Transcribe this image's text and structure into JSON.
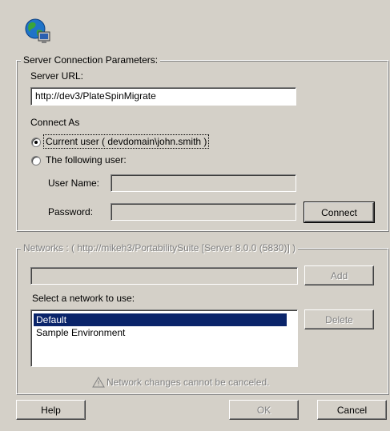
{
  "icon": "globe-computer-icon",
  "server_group": {
    "title": "Server Connection Parameters:",
    "url_label": "Server URL:",
    "url_value": "http://dev3/PlateSpinMigrate",
    "connect_as_label": "Connect As",
    "current_user_label": "Current user ( devdomain\\john.smith )",
    "following_user_label": "The following user:",
    "username_label": "User Name:",
    "username_value": "",
    "password_label": "Password:",
    "password_value": "",
    "connect_button": "Connect"
  },
  "networks_group": {
    "title": "Networks : ( http://mikeh3/PortabilitySuite [Server 8.0.0 (5830)] )",
    "new_network_value": "",
    "add_button": "Add",
    "select_label": "Select a network to use:",
    "networks": [
      "Default",
      "Sample Environment"
    ],
    "selected_index": 0,
    "delete_button": "Delete",
    "warning_icon": "warning-icon",
    "warning_text": "Network changes cannot be canceled."
  },
  "footer": {
    "help_button": "Help",
    "ok_button": "OK",
    "cancel_button": "Cancel"
  }
}
